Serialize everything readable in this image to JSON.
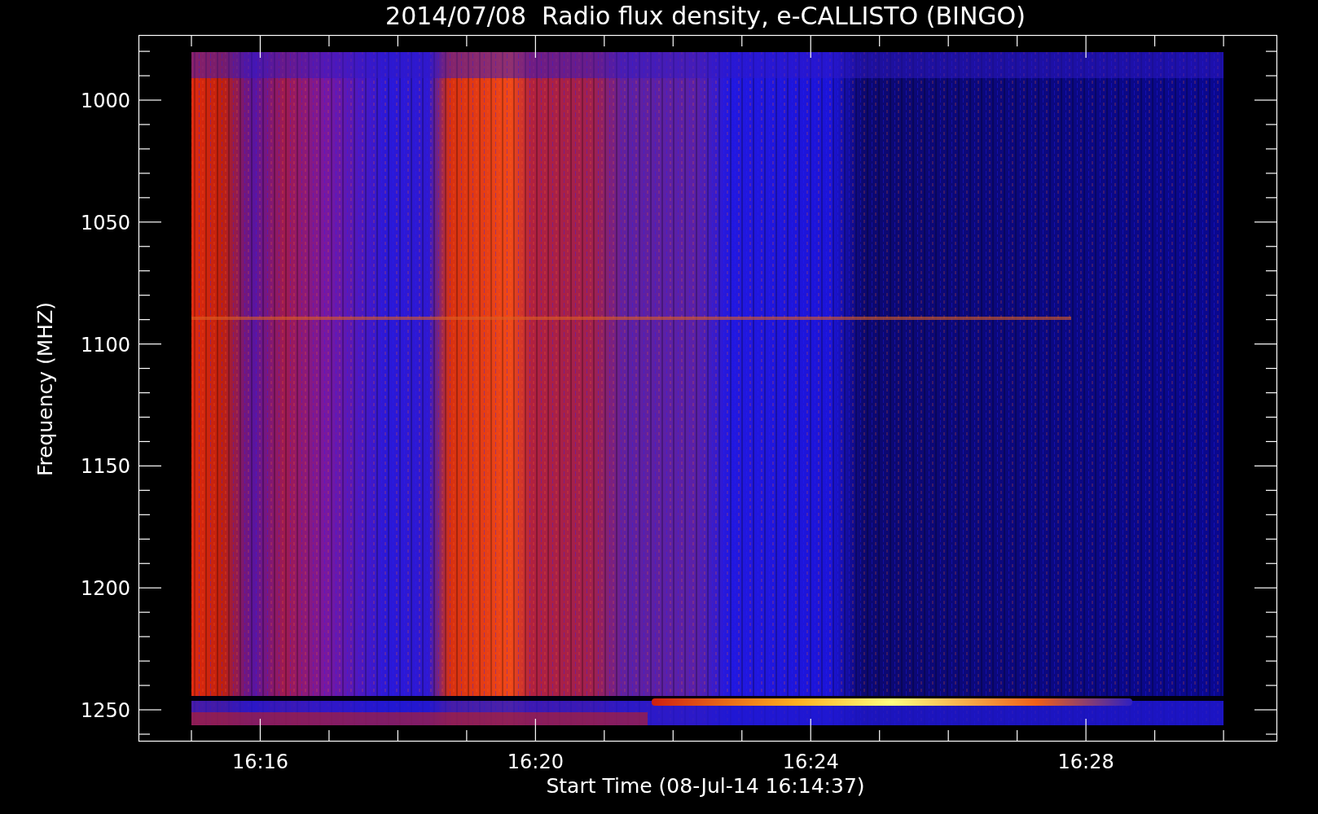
{
  "title": "2014/07/08  Radio flux density, e-CALLISTO (BINGO)",
  "y_axis": {
    "label": "Frequency (MHZ)",
    "tick_labels": [
      "1000",
      "1050",
      "1100",
      "1150",
      "1200",
      "1250"
    ]
  },
  "x_axis": {
    "label": "Start Time (08-Jul-14 16:14:37)",
    "tick_labels": [
      "16:16",
      "16:20",
      "16:24",
      "16:28"
    ]
  }
}
